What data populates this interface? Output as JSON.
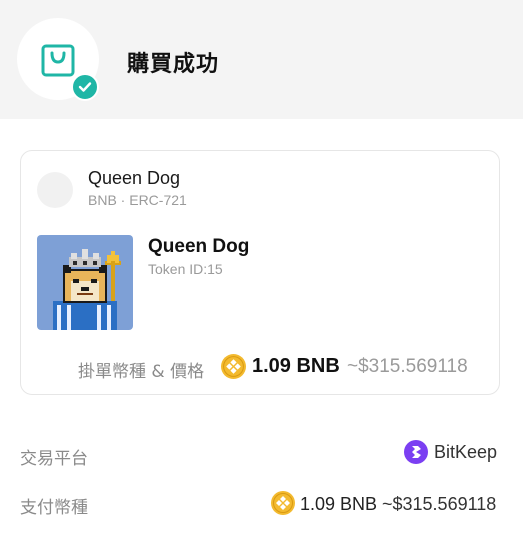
{
  "header": {
    "title": "購買成功"
  },
  "card": {
    "collection": {
      "name": "Queen Dog",
      "meta": "BNB · ERC-721"
    },
    "nft": {
      "name": "Queen Dog",
      "token": "Token ID:15"
    },
    "price": {
      "label": "掛單幣種 & 價格",
      "amount": "1.09 BNB",
      "usd": "~$315.569118"
    }
  },
  "details": {
    "exchange": {
      "label": "交易平台",
      "value": "BitKeep"
    },
    "payment": {
      "label": "支付幣種",
      "amount": "1.09 BNB",
      "usd": "~$315.569118"
    }
  },
  "colors": {
    "success": "#1fb6a6",
    "bnb": "#f3ba2f",
    "bitkeep": "#7b3ff2"
  },
  "icons": {
    "bag": "shopping-bag-icon",
    "check": "check-icon",
    "coin": "bnb-coin-icon",
    "platform": "bitkeep-logo-icon"
  }
}
